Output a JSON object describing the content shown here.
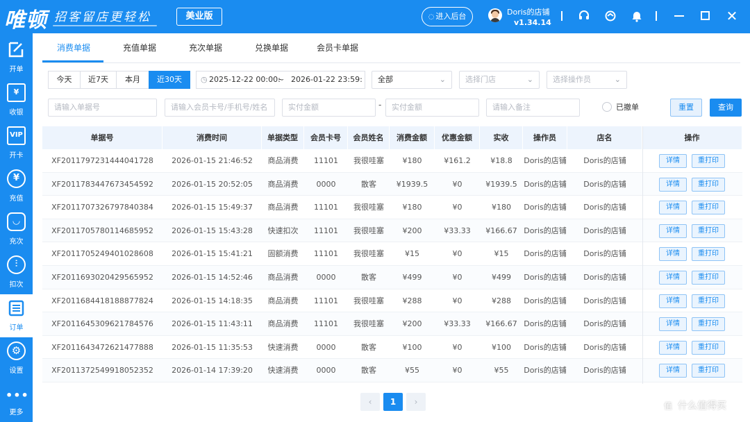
{
  "titlebar": {
    "logo": "唯顿",
    "slogan": "招客留店更轻松",
    "edition": "美业版",
    "backend_button": "进入后台",
    "user_name": "Doris的店铺",
    "version": "v1.34.14"
  },
  "sidebar": {
    "items": [
      {
        "label": "开单",
        "icon": "pen-icon"
      },
      {
        "label": "收银",
        "icon": "cashier-icon"
      },
      {
        "label": "开卡",
        "icon": "vip-card-icon"
      },
      {
        "label": "充值",
        "icon": "yuan-plus-icon"
      },
      {
        "label": "充次",
        "icon": "recharge-times-icon"
      },
      {
        "label": "扣次",
        "icon": "deduct-times-icon"
      },
      {
        "label": "订单",
        "icon": "orders-icon"
      },
      {
        "label": "设置",
        "icon": "gear-icon"
      },
      {
        "label": "更多",
        "icon": "more-icon"
      }
    ],
    "active_index": 6
  },
  "tabs": [
    "消费单据",
    "充值单据",
    "充次单据",
    "兑换单据",
    "会员卡单据"
  ],
  "active_tab": 0,
  "date_presets": [
    "今天",
    "近7天",
    "本月",
    "近30天"
  ],
  "active_preset": 3,
  "filters": {
    "date_start": "2025-12-22 00:00:",
    "date_sep": "~",
    "date_end": "2026-01-22 23:59:",
    "type_select": "全部",
    "store_placeholder": "选择门店",
    "operator_placeholder": "选择操作员",
    "order_no_placeholder": "请输入单据号",
    "member_placeholder": "请输入会员卡号/手机号/姓名",
    "amount_min_placeholder": "实付金额",
    "amount_max_placeholder": "实付金额",
    "remark_placeholder": "请输入备注",
    "voided_label": "已撤单",
    "reset_label": "重置",
    "query_label": "查询"
  },
  "table": {
    "columns": [
      "单据号",
      "消费时间",
      "单据类型",
      "会员卡号",
      "会员姓名",
      "消费金额",
      "优惠金额",
      "实收",
      "操作员",
      "店名",
      "操作"
    ],
    "detail_label": "详情",
    "reprint_label": "重打印",
    "rows": [
      [
        "XF2011797231444041728",
        "2026-01-15 21:46:52",
        "商品消费",
        "11101",
        "我很哇塞",
        "¥180",
        "¥161.2",
        "¥18.8",
        "Doris的店铺",
        "Doris的店铺"
      ],
      [
        "XF2011783447673454592",
        "2026-01-15 20:52:05",
        "商品消费",
        "0000",
        "散客",
        "¥1939.5",
        "¥0",
        "¥1939.5",
        "Doris的店铺",
        "Doris的店铺"
      ],
      [
        "XF2011707326797840384",
        "2026-01-15 15:49:37",
        "商品消费",
        "11101",
        "我很哇塞",
        "¥180",
        "¥0",
        "¥180",
        "Doris的店铺",
        "Doris的店铺"
      ],
      [
        "XF2011705780114685952",
        "2026-01-15 15:43:28",
        "快速扣次",
        "11101",
        "我很哇塞",
        "¥200",
        "¥33.33",
        "¥166.67",
        "Doris的店铺",
        "Doris的店铺"
      ],
      [
        "XF2011705249401028608",
        "2026-01-15 15:41:21",
        "固额消费",
        "11101",
        "我很哇塞",
        "¥15",
        "¥0",
        "¥15",
        "Doris的店铺",
        "Doris的店铺"
      ],
      [
        "XF2011693020429565952",
        "2026-01-15 14:52:46",
        "商品消费",
        "0000",
        "散客",
        "¥499",
        "¥0",
        "¥499",
        "Doris的店铺",
        "Doris的店铺"
      ],
      [
        "XF2011684418188877824",
        "2026-01-15 14:18:35",
        "商品消费",
        "11101",
        "我很哇塞",
        "¥288",
        "¥0",
        "¥288",
        "Doris的店铺",
        "Doris的店铺"
      ],
      [
        "XF2011645309621784576",
        "2026-01-15 11:43:11",
        "商品消费",
        "11101",
        "我很哇塞",
        "¥200",
        "¥33.33",
        "¥166.67",
        "Doris的店铺",
        "Doris的店铺"
      ],
      [
        "XF2011643472621477888",
        "2026-01-15 11:35:53",
        "快速消费",
        "0000",
        "散客",
        "¥100",
        "¥0",
        "¥100",
        "Doris的店铺",
        "Doris的店铺"
      ],
      [
        "XF2011372549918052352",
        "2026-01-14 17:39:20",
        "快速消费",
        "0000",
        "散客",
        "¥55",
        "¥0",
        "¥55",
        "Doris的店铺",
        "Doris的店铺"
      ]
    ]
  },
  "pagination": {
    "prev": "‹",
    "current": "1",
    "next": "›"
  },
  "watermark": "什么值得买",
  "watermark_mark": "值",
  "colors": {
    "primary": "#1a8cf0",
    "header_bg": "#edf4fd",
    "page_bg": "#ffffff"
  }
}
